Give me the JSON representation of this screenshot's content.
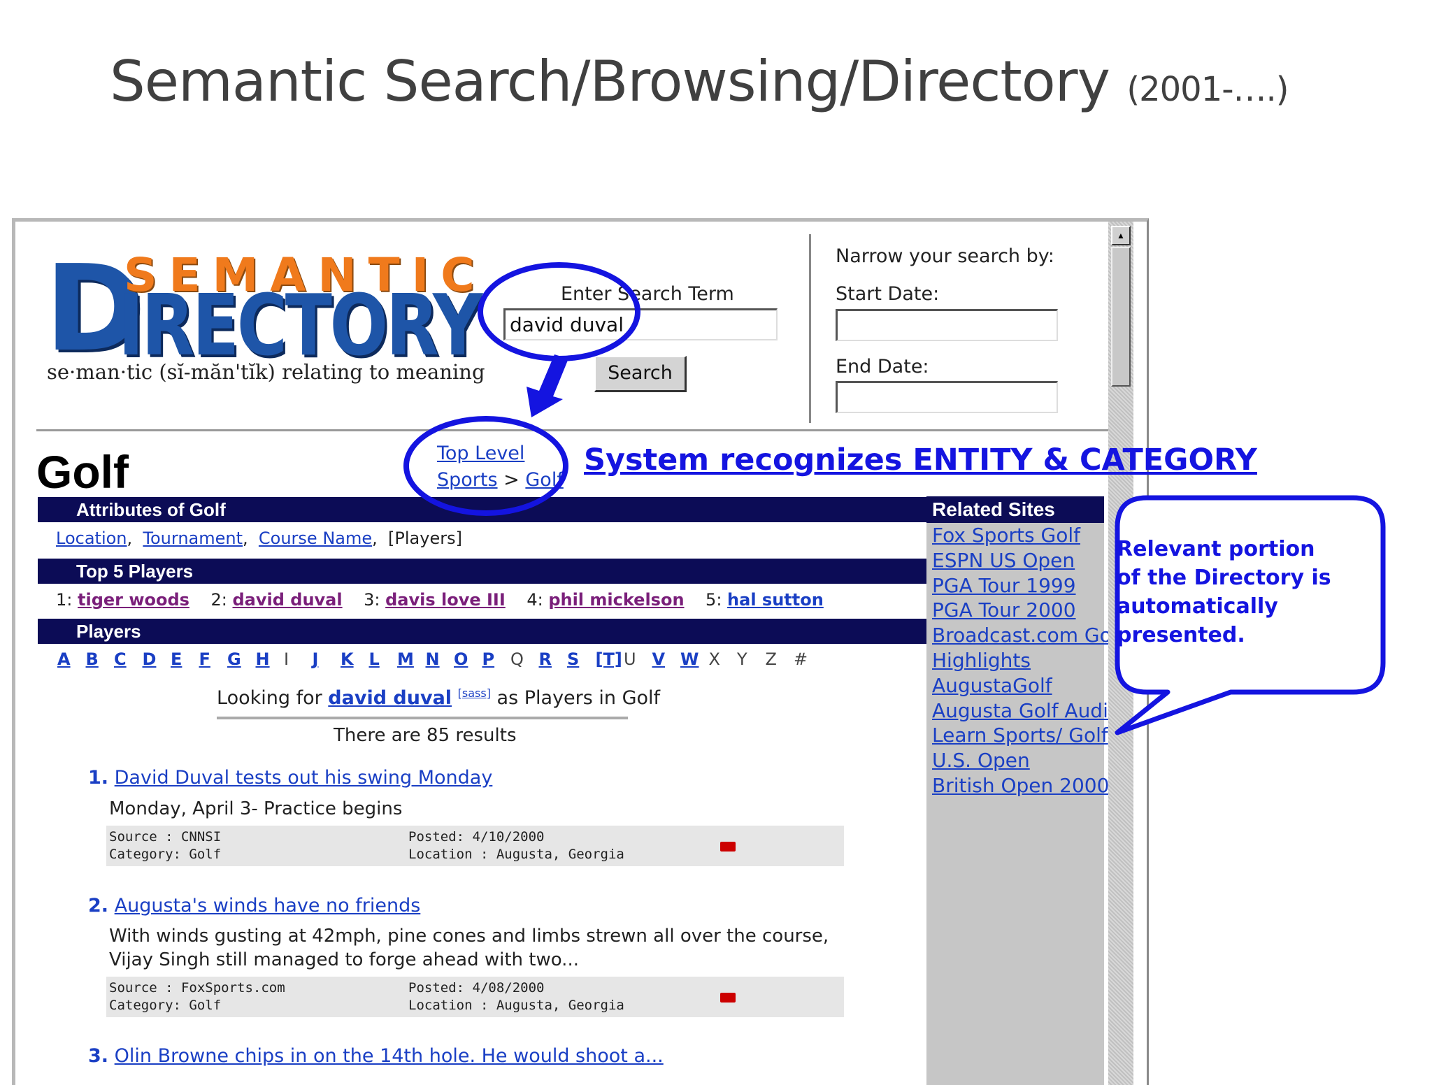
{
  "slide": {
    "title": "Semantic Search/Browsing/Directory",
    "title_suffix": "(2001-….)"
  },
  "logo": {
    "semantic": "SEMANTIC",
    "d": "D",
    "irectory": "IRECTORY",
    "tagline": "se·man·tic (sĭ-măn'tĭk) relating to meaning"
  },
  "search": {
    "label": "Enter Search Term",
    "value": "david duval",
    "button": "Search"
  },
  "narrow": {
    "heading": "Narrow your search by:",
    "start_label": "Start Date:",
    "end_label": "End Date:",
    "start_value": "",
    "end_value": ""
  },
  "page": {
    "heading": "Golf",
    "breadcrumb_top": "Top Level",
    "breadcrumb_sports": "Sports",
    "breadcrumb_sep": ">",
    "breadcrumb_golf": "Golf"
  },
  "attributes": {
    "header": "Attributes of Golf",
    "items": [
      "Location",
      "Tournament",
      "Course Name"
    ],
    "current": "[Players]"
  },
  "top_players": {
    "header": "Top 5 Players",
    "players": [
      {
        "rank": "1:",
        "name": "tiger woods"
      },
      {
        "rank": "2:",
        "name": "david duval"
      },
      {
        "rank": "3:",
        "name": "davis love III"
      },
      {
        "rank": "4:",
        "name": "phil mickelson"
      },
      {
        "rank": "5:",
        "name": "hal sutton"
      }
    ]
  },
  "players": {
    "header": "Players",
    "alphabet": [
      "A",
      "B",
      "C",
      "D",
      "E",
      "F",
      "G",
      "H",
      "I",
      "J",
      "K",
      "L",
      "M",
      "N",
      "O",
      "P",
      "Q",
      "R",
      "S",
      "[T]",
      "U",
      "V",
      "W",
      "X",
      "Y",
      "Z",
      "#"
    ],
    "active_letters": [
      "A",
      "B",
      "C",
      "D",
      "E",
      "F",
      "G",
      "H",
      "J",
      "K",
      "L",
      "M",
      "N",
      "O",
      "P",
      "R",
      "S",
      "[T]",
      "V",
      "W"
    ]
  },
  "results": {
    "looking_prefix": "Looking for",
    "looking_name": "david duval",
    "looking_tag": "[sass]",
    "looking_suffix": "as Players in Golf",
    "count_text": "There are 85 results",
    "items": [
      {
        "num": "1.",
        "title": "David Duval tests out his swing Monday",
        "desc": "Monday, April 3- Practice begins",
        "source": "Source : CNNSI",
        "category": "Category: Golf",
        "posted": "Posted: 4/10/2000",
        "location": "Location : Augusta, Georgia"
      },
      {
        "num": "2.",
        "title": "Augusta's winds have no friends",
        "desc": "With winds gusting at 42mph, pine cones and limbs strewn all over the course, Vijay Singh still managed to forge ahead with two...",
        "source": "Source : FoxSports.com",
        "category": "Category: Golf",
        "posted": "Posted: 4/08/2000",
        "location": "Location : Augusta, Georgia"
      },
      {
        "num": "3.",
        "title": "Olin Browne chips in on the 14th hole. He would shoot a..."
      }
    ]
  },
  "related": {
    "header": "Related Sites",
    "links": [
      "Fox Sports Golf",
      "ESPN US Open",
      "PGA Tour 1999",
      "PGA Tour 2000",
      "Broadcast.com Golf",
      "Highlights",
      "AugustaGolf",
      "Augusta Golf Audio",
      "Learn Sports/ Golf",
      "U.S. Open",
      "British Open 2000"
    ]
  },
  "annotations": {
    "entity_category": "System recognizes ENTITY & CATEGORY",
    "callout_lines": [
      "Relevant portion",
      "of the Directory is",
      "automatically",
      "presented."
    ],
    "color": "#1414e0"
  },
  "icons": {
    "video": "video-camera-icon",
    "scroll_up": "scroll-up-arrow-icon"
  }
}
